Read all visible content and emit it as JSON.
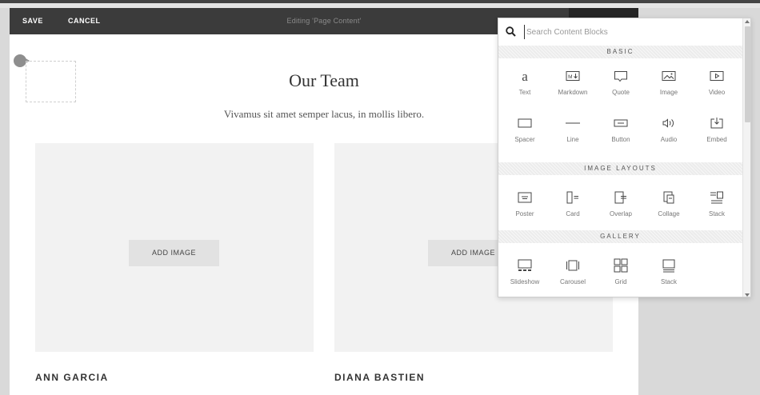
{
  "toolbar": {
    "save_label": "SAVE",
    "cancel_label": "CANCEL",
    "title": "Editing 'Page Content'"
  },
  "page": {
    "title": "Our Team",
    "subtitle": "Vivamus sit amet semper lacus, in mollis libero."
  },
  "members": [
    {
      "name": "ANN GARCIA",
      "add_image_label": "ADD IMAGE"
    },
    {
      "name": "DIANA BASTIEN",
      "add_image_label": "ADD IMAGE"
    }
  ],
  "picker": {
    "search_placeholder": "Search Content Blocks",
    "sections": [
      {
        "title": "BASIC",
        "blocks": [
          {
            "label": "Text",
            "icon": "text-icon"
          },
          {
            "label": "Markdown",
            "icon": "markdown-icon"
          },
          {
            "label": "Quote",
            "icon": "quote-icon"
          },
          {
            "label": "Image",
            "icon": "image-icon"
          },
          {
            "label": "Video",
            "icon": "video-icon"
          },
          {
            "label": "Spacer",
            "icon": "spacer-icon"
          },
          {
            "label": "Line",
            "icon": "line-icon"
          },
          {
            "label": "Button",
            "icon": "button-icon"
          },
          {
            "label": "Audio",
            "icon": "audio-icon"
          },
          {
            "label": "Embed",
            "icon": "embed-icon"
          }
        ]
      },
      {
        "title": "IMAGE LAYOUTS",
        "blocks": [
          {
            "label": "Poster",
            "icon": "poster-icon"
          },
          {
            "label": "Card",
            "icon": "card-icon"
          },
          {
            "label": "Overlap",
            "icon": "overlap-icon"
          },
          {
            "label": "Collage",
            "icon": "collage-icon"
          },
          {
            "label": "Stack",
            "icon": "stack-icon"
          }
        ]
      },
      {
        "title": "GALLERY",
        "blocks": [
          {
            "label": "Slideshow",
            "icon": "slideshow-icon"
          },
          {
            "label": "Carousel",
            "icon": "carousel-icon"
          },
          {
            "label": "Grid",
            "icon": "grid-icon"
          },
          {
            "label": "Stack",
            "icon": "gallery-stack-icon"
          }
        ]
      }
    ]
  }
}
